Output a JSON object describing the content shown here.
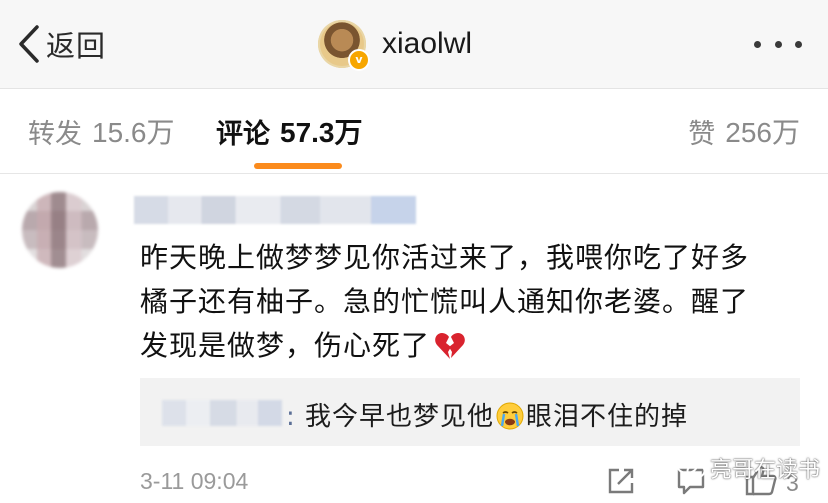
{
  "header": {
    "back_label": "返回",
    "username": "xiaolwl",
    "verified_badge": "v"
  },
  "tabs": [
    {
      "label": "转发",
      "count": "15.6万",
      "active": false
    },
    {
      "label": "评论",
      "count": "57.3万",
      "active": true
    },
    {
      "label": "赞",
      "count": "256万",
      "active": false
    }
  ],
  "comment": {
    "lines": [
      "昨天晚上做梦梦见你活过来了，我喂你吃了好多",
      "橘子还有柚子。急的忙慌叫人通知你老婆。醒了",
      "发现是做梦，伤心死了"
    ],
    "reply": {
      "prefix": ":",
      "text_before": " 我今早也梦见他",
      "text_after": "眼泪不住的掉"
    },
    "time": "3-11 09:04",
    "like_count": "3"
  },
  "watermark": "亮哥在读书",
  "colors": {
    "accent": "#fb8b1d",
    "verified": "#f7a600",
    "reply_bg": "#f2f2f2"
  }
}
